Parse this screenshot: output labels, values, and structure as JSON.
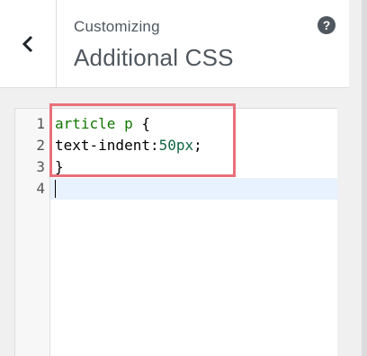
{
  "header": {
    "subtitle": "Customizing",
    "title": "Additional CSS",
    "back_icon": "chevron-left-icon",
    "help_label": "?",
    "help_icon": "help-icon"
  },
  "editor": {
    "line_numbers": [
      "1",
      "2",
      "3",
      "4"
    ],
    "lines": [
      {
        "selector": "article p",
        "punct": " {"
      },
      {
        "prop": "text-indent:",
        "num": "50px",
        "end": ";"
      },
      {
        "text": "}"
      },
      {
        "text": ""
      }
    ],
    "active_line": 4
  },
  "colors": {
    "highlight_border": "#e8707a",
    "selector": "#117700",
    "number": "#116644",
    "active_line_bg": "#e8f2fe"
  }
}
